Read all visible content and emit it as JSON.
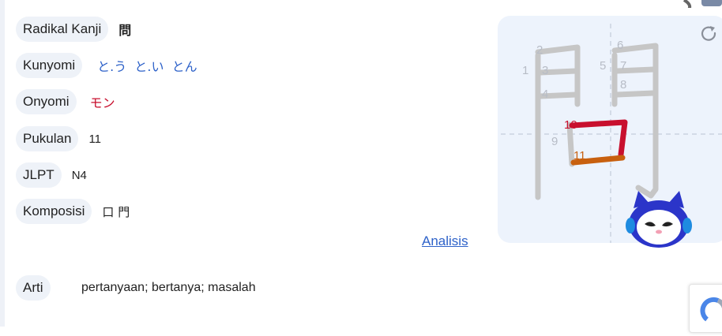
{
  "fields": {
    "radikal": {
      "label": "Radikal Kanji",
      "value": "問"
    },
    "kunyomi": {
      "label": "Kunyomi",
      "value": "と.う  と.い  とん"
    },
    "onyomi": {
      "label": "Onyomi",
      "value": "モン"
    },
    "pukulan": {
      "label": "Pukulan",
      "value": "11"
    },
    "jlpt": {
      "label": "JLPT",
      "value": "N4"
    },
    "komposisi": {
      "label": "Komposisi",
      "value": "口 門"
    }
  },
  "analisis_link": "Analisis",
  "arti": {
    "label": "Arti",
    "value": "pertanyaan; bertanya; masalah"
  },
  "stroke_panel": {
    "stroke_numbers": [
      "1",
      "2",
      "3",
      "4",
      "5",
      "6",
      "7",
      "8",
      "9",
      "10",
      "11"
    ],
    "colors": {
      "ghost": "#c6c6c6",
      "current": "#c8102e",
      "last": "#c8600f",
      "accent": "#2e62c9"
    }
  },
  "icons": {
    "refresh": "refresh-icon",
    "mascot": "mascot-robot-icon"
  }
}
